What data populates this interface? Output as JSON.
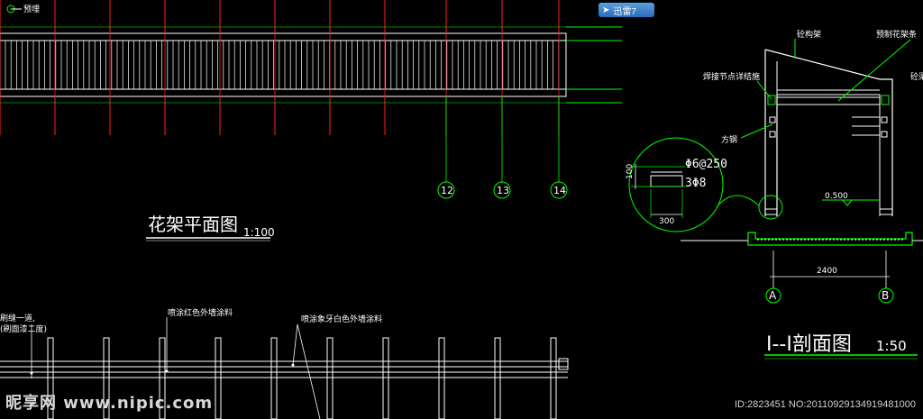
{
  "plan_view": {
    "title": "花架平面图",
    "scale": "1:100",
    "top_left_label": "预埋",
    "grid_labels": [
      "12",
      "13",
      "14"
    ]
  },
  "section_view": {
    "title": "I--I剖面图",
    "scale": "1:50",
    "labels": {
      "concrete_frame": "砼构架",
      "precast_bars": "预制花架条",
      "weld_detail": "焊接节点详结施",
      "square_steel": "方钢",
      "concrete_right": "砼梁"
    },
    "rebar_1": "Φ6@250",
    "rebar_2": "3Φ8",
    "dim_300": "300",
    "dim_100": "100",
    "level": "0.500",
    "width_dim": "2400",
    "axis_a": "A",
    "axis_b": "B"
  },
  "elevation_view": {
    "note_1": "喷涂红色外墙涂料",
    "note_2": "喷涂象牙白色外墙涂料",
    "note_left_1": "刷缝一道,",
    "note_left_2": "(刷面漆二度)"
  },
  "overlay": {
    "badge_label": "迅雷7",
    "watermark": "昵享网 www.nipic.com",
    "id_line": "ID:2823451 NO:20110929134919481000"
  },
  "colors": {
    "line_white": "#ffffff",
    "line_red": "#ff2020",
    "line_green": "#00ff00",
    "background": "#000000"
  }
}
